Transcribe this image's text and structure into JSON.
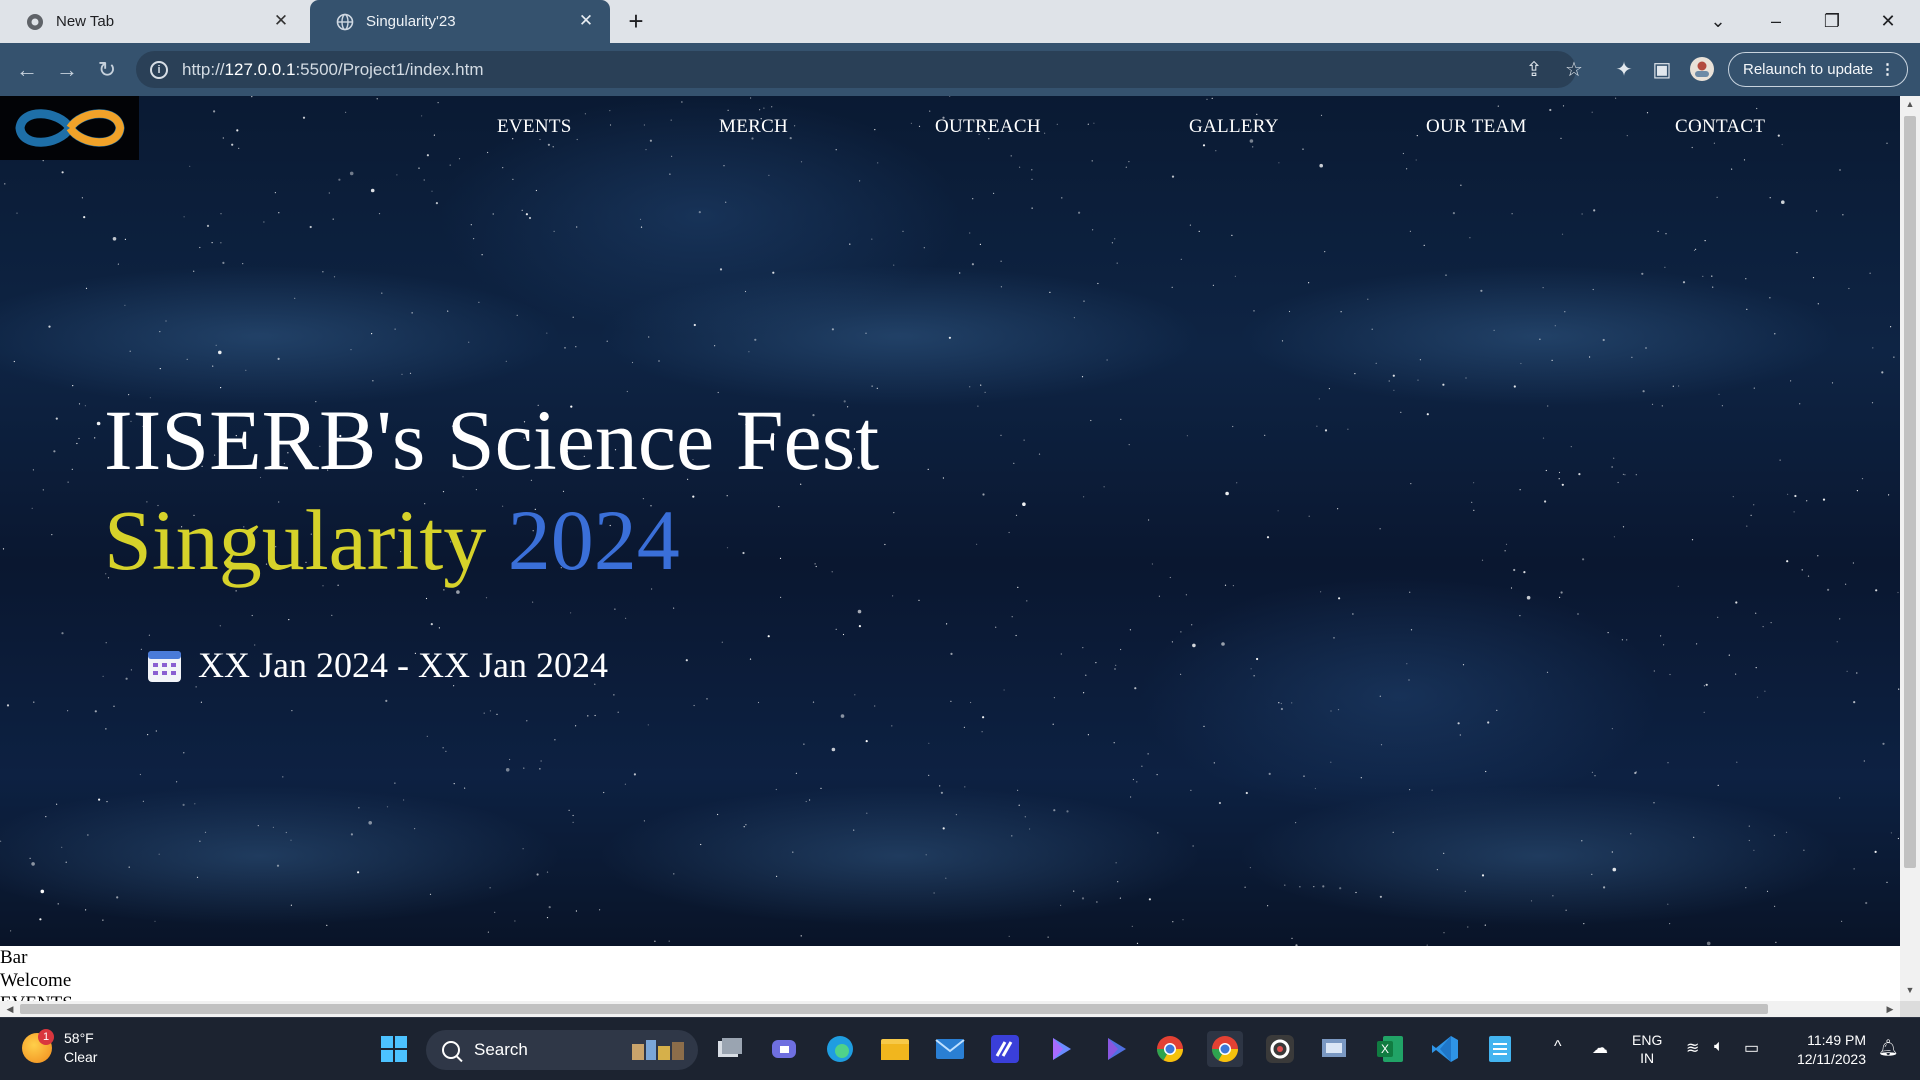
{
  "browser": {
    "tabs": [
      {
        "title": "New Tab",
        "active": false
      },
      {
        "title": "Singularity'23",
        "active": true
      }
    ],
    "url": {
      "prefix": "http://",
      "host": "127.0.0.1",
      "path": ":5500/Project1/index.htm"
    },
    "relaunch_label": "Relaunch to update",
    "accent": "#35526e"
  },
  "site": {
    "nav": [
      "EVENTS",
      "MERCH",
      "OUTREACH",
      "GALLERY",
      "OUR TEAM",
      "CONTACT"
    ],
    "headline": "IISERB's Science Fest",
    "subline_word": "Singularity",
    "subline_year": "2024",
    "dates": "XX Jan 2024 - XX Jan 2024",
    "below_hero": [
      "Bar",
      "Welcome",
      "EVENTS"
    ],
    "colors": {
      "yellow": "#d6d22a",
      "blue": "#3a6fd8"
    }
  },
  "taskbar": {
    "weather_temp": "58°F",
    "weather_desc": "Clear",
    "weather_badge": "1",
    "search_label": "Search",
    "lang_line1": "ENG",
    "lang_line2": "IN",
    "time": "11:49 PM",
    "date": "12/11/2023",
    "app_icons": [
      "start-icon",
      "widgets-icon",
      "task-view-icon",
      "teams-icon",
      "edge-icon",
      "file-explorer-icon",
      "mail-icon",
      "app-icon",
      "app-icon",
      "app-icon",
      "chrome-icon",
      "chrome-icon",
      "app-icon",
      "app-icon",
      "excel-icon",
      "vscode-icon",
      "notepad-icon"
    ]
  }
}
